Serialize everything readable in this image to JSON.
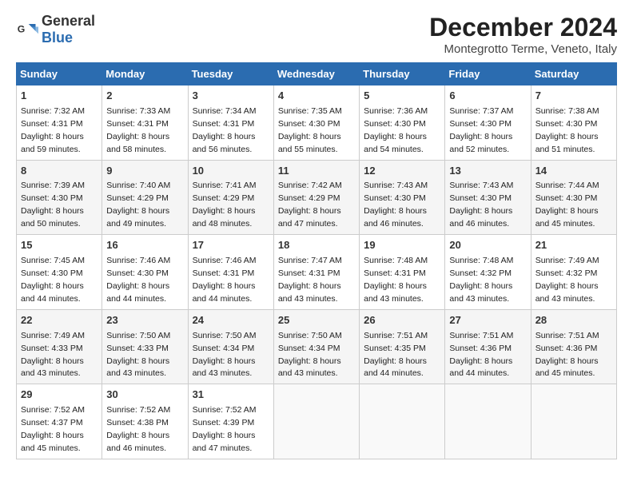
{
  "logo": {
    "general": "General",
    "blue": "Blue"
  },
  "title": "December 2024",
  "subtitle": "Montegrotto Terme, Veneto, Italy",
  "days_header": [
    "Sunday",
    "Monday",
    "Tuesday",
    "Wednesday",
    "Thursday",
    "Friday",
    "Saturday"
  ],
  "weeks": [
    [
      {
        "day": "1",
        "sunrise": "7:32 AM",
        "sunset": "4:31 PM",
        "daylight": "8 hours and 59 minutes."
      },
      {
        "day": "2",
        "sunrise": "7:33 AM",
        "sunset": "4:31 PM",
        "daylight": "8 hours and 58 minutes."
      },
      {
        "day": "3",
        "sunrise": "7:34 AM",
        "sunset": "4:31 PM",
        "daylight": "8 hours and 56 minutes."
      },
      {
        "day": "4",
        "sunrise": "7:35 AM",
        "sunset": "4:30 PM",
        "daylight": "8 hours and 55 minutes."
      },
      {
        "day": "5",
        "sunrise": "7:36 AM",
        "sunset": "4:30 PM",
        "daylight": "8 hours and 54 minutes."
      },
      {
        "day": "6",
        "sunrise": "7:37 AM",
        "sunset": "4:30 PM",
        "daylight": "8 hours and 52 minutes."
      },
      {
        "day": "7",
        "sunrise": "7:38 AM",
        "sunset": "4:30 PM",
        "daylight": "8 hours and 51 minutes."
      }
    ],
    [
      {
        "day": "8",
        "sunrise": "7:39 AM",
        "sunset": "4:30 PM",
        "daylight": "8 hours and 50 minutes."
      },
      {
        "day": "9",
        "sunrise": "7:40 AM",
        "sunset": "4:29 PM",
        "daylight": "8 hours and 49 minutes."
      },
      {
        "day": "10",
        "sunrise": "7:41 AM",
        "sunset": "4:29 PM",
        "daylight": "8 hours and 48 minutes."
      },
      {
        "day": "11",
        "sunrise": "7:42 AM",
        "sunset": "4:29 PM",
        "daylight": "8 hours and 47 minutes."
      },
      {
        "day": "12",
        "sunrise": "7:43 AM",
        "sunset": "4:30 PM",
        "daylight": "8 hours and 46 minutes."
      },
      {
        "day": "13",
        "sunrise": "7:43 AM",
        "sunset": "4:30 PM",
        "daylight": "8 hours and 46 minutes."
      },
      {
        "day": "14",
        "sunrise": "7:44 AM",
        "sunset": "4:30 PM",
        "daylight": "8 hours and 45 minutes."
      }
    ],
    [
      {
        "day": "15",
        "sunrise": "7:45 AM",
        "sunset": "4:30 PM",
        "daylight": "8 hours and 44 minutes."
      },
      {
        "day": "16",
        "sunrise": "7:46 AM",
        "sunset": "4:30 PM",
        "daylight": "8 hours and 44 minutes."
      },
      {
        "day": "17",
        "sunrise": "7:46 AM",
        "sunset": "4:31 PM",
        "daylight": "8 hours and 44 minutes."
      },
      {
        "day": "18",
        "sunrise": "7:47 AM",
        "sunset": "4:31 PM",
        "daylight": "8 hours and 43 minutes."
      },
      {
        "day": "19",
        "sunrise": "7:48 AM",
        "sunset": "4:31 PM",
        "daylight": "8 hours and 43 minutes."
      },
      {
        "day": "20",
        "sunrise": "7:48 AM",
        "sunset": "4:32 PM",
        "daylight": "8 hours and 43 minutes."
      },
      {
        "day": "21",
        "sunrise": "7:49 AM",
        "sunset": "4:32 PM",
        "daylight": "8 hours and 43 minutes."
      }
    ],
    [
      {
        "day": "22",
        "sunrise": "7:49 AM",
        "sunset": "4:33 PM",
        "daylight": "8 hours and 43 minutes."
      },
      {
        "day": "23",
        "sunrise": "7:50 AM",
        "sunset": "4:33 PM",
        "daylight": "8 hours and 43 minutes."
      },
      {
        "day": "24",
        "sunrise": "7:50 AM",
        "sunset": "4:34 PM",
        "daylight": "8 hours and 43 minutes."
      },
      {
        "day": "25",
        "sunrise": "7:50 AM",
        "sunset": "4:34 PM",
        "daylight": "8 hours and 43 minutes."
      },
      {
        "day": "26",
        "sunrise": "7:51 AM",
        "sunset": "4:35 PM",
        "daylight": "8 hours and 44 minutes."
      },
      {
        "day": "27",
        "sunrise": "7:51 AM",
        "sunset": "4:36 PM",
        "daylight": "8 hours and 44 minutes."
      },
      {
        "day": "28",
        "sunrise": "7:51 AM",
        "sunset": "4:36 PM",
        "daylight": "8 hours and 45 minutes."
      }
    ],
    [
      {
        "day": "29",
        "sunrise": "7:52 AM",
        "sunset": "4:37 PM",
        "daylight": "8 hours and 45 minutes."
      },
      {
        "day": "30",
        "sunrise": "7:52 AM",
        "sunset": "4:38 PM",
        "daylight": "8 hours and 46 minutes."
      },
      {
        "day": "31",
        "sunrise": "7:52 AM",
        "sunset": "4:39 PM",
        "daylight": "8 hours and 47 minutes."
      },
      null,
      null,
      null,
      null
    ]
  ],
  "labels": {
    "sunrise": "Sunrise:",
    "sunset": "Sunset:",
    "daylight": "Daylight:"
  },
  "colors": {
    "header_bg": "#2b6cb0",
    "header_text": "#ffffff"
  }
}
